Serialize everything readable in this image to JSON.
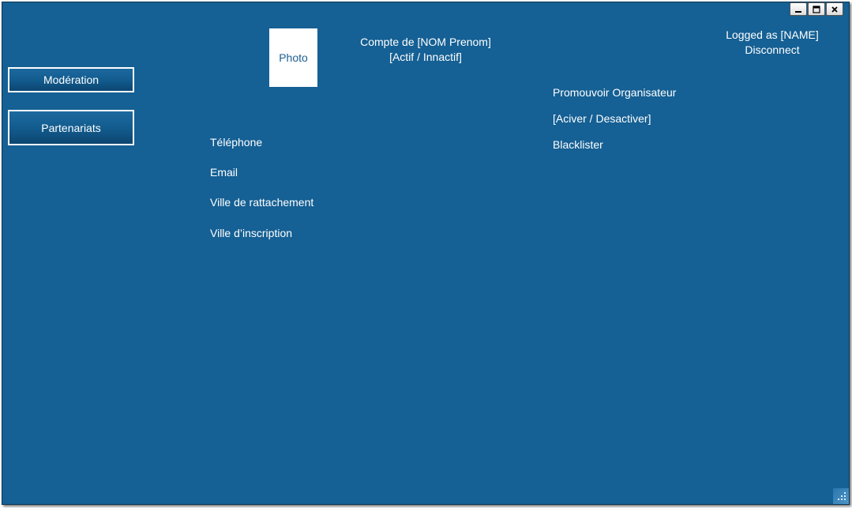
{
  "window_controls": {
    "minimize_icon": "minimize-icon",
    "maximize_icon": "maximize-icon",
    "close_icon": "close-icon"
  },
  "sidebar": {
    "items": [
      {
        "label": "Modération"
      },
      {
        "label": "Partenariats"
      }
    ]
  },
  "profile": {
    "photo_label": "Photo",
    "account_title": "Compte de [NOM Prenom]",
    "account_status": "[Actif / Innactif]"
  },
  "header": {
    "logged_as": "Logged as [NAME]",
    "disconnect": "Disconnect"
  },
  "actions": {
    "promote": "Promouvoir Organisateur",
    "toggle_active": "[Aciver / Desactiver]",
    "blacklist": "Blacklister"
  },
  "details": {
    "phone": "Téléphone",
    "email": "Email",
    "home_city": "Ville de rattachement",
    "signup_city": "Ville d’inscription"
  },
  "colors": {
    "background": "#156094",
    "text": "#ffffff"
  }
}
